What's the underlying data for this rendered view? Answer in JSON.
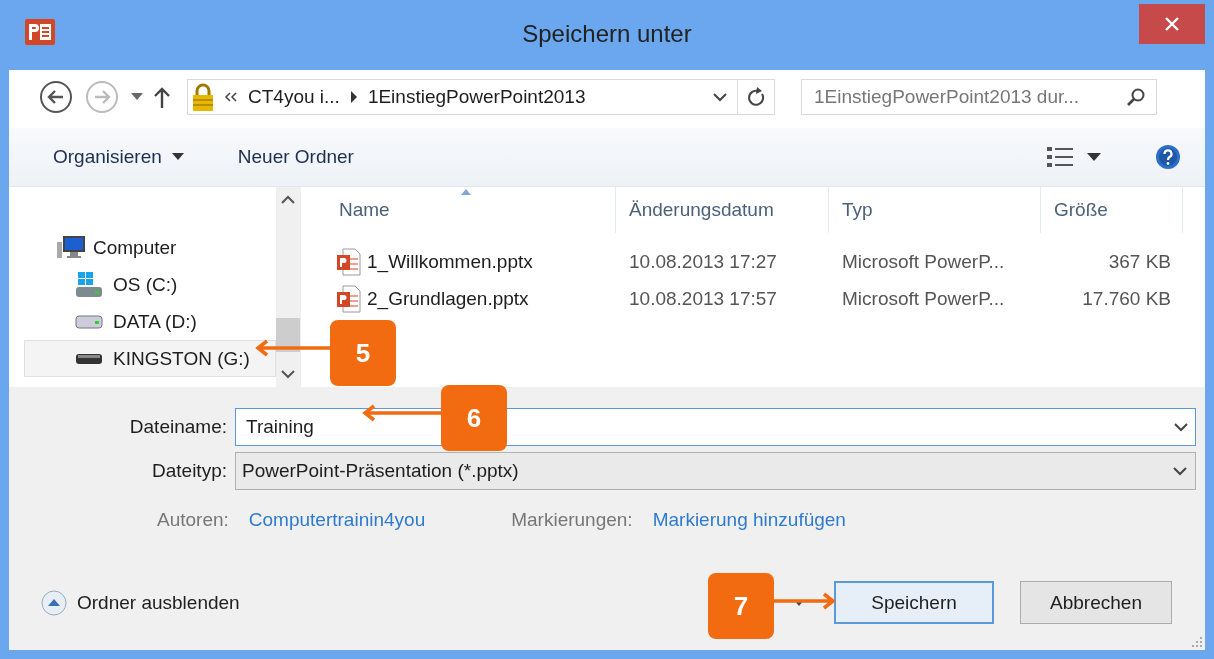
{
  "window": {
    "title": "Speichern unter"
  },
  "nav": {
    "path": [
      {
        "label": "CT4you i..."
      },
      {
        "label": "1EinstiegPowerPoint2013"
      }
    ],
    "search": {
      "placeholder": "1EinstiegPowerPoint2013 dur..."
    }
  },
  "toolbar": {
    "items": [
      {
        "label": "Organisieren",
        "dropdown": true
      },
      {
        "label": "Neuer Ordner",
        "dropdown": false
      }
    ]
  },
  "sidebar": {
    "items": [
      {
        "label": "Computer",
        "kind": "computer",
        "selected": false,
        "children": [
          {
            "label": "OS (C:)",
            "kind": "system-drive",
            "selected": false
          },
          {
            "label": "DATA (D:)",
            "kind": "drive",
            "selected": false
          },
          {
            "label": "KINGSTON (G:)",
            "kind": "usb-drive",
            "selected": true
          }
        ]
      }
    ]
  },
  "table": {
    "columns": [
      "Name",
      "Änderungsdatum",
      "Typ",
      "Größe"
    ],
    "rows": [
      {
        "name": "1_Willkommen.pptx",
        "date": "10.08.2013 17:27",
        "type": "Microsoft PowerP...",
        "size": "367 KB"
      },
      {
        "name": "2_Grundlagen.pptx",
        "date": "10.08.2013 17:57",
        "type": "Microsoft PowerP...",
        "size": "17.760 KB"
      }
    ]
  },
  "form": {
    "filename": {
      "label": "Dateiname:",
      "value": "Training"
    },
    "filetype": {
      "label": "Dateityp:",
      "value": "PowerPoint-Präsentation (*.pptx)"
    },
    "meta": [
      {
        "label": "Autoren:",
        "value": "Computertrainin4you"
      },
      {
        "label": "Markierungen:",
        "value": "Markierung hinzufügen"
      }
    ]
  },
  "footer": {
    "toggle": "Ordner ausblenden",
    "buttons": [
      {
        "label": "Speichern",
        "default": true
      },
      {
        "label": "Abbrechen",
        "default": false
      }
    ]
  },
  "callouts": [
    {
      "label": "5"
    },
    {
      "label": "6"
    },
    {
      "label": "7"
    }
  ]
}
